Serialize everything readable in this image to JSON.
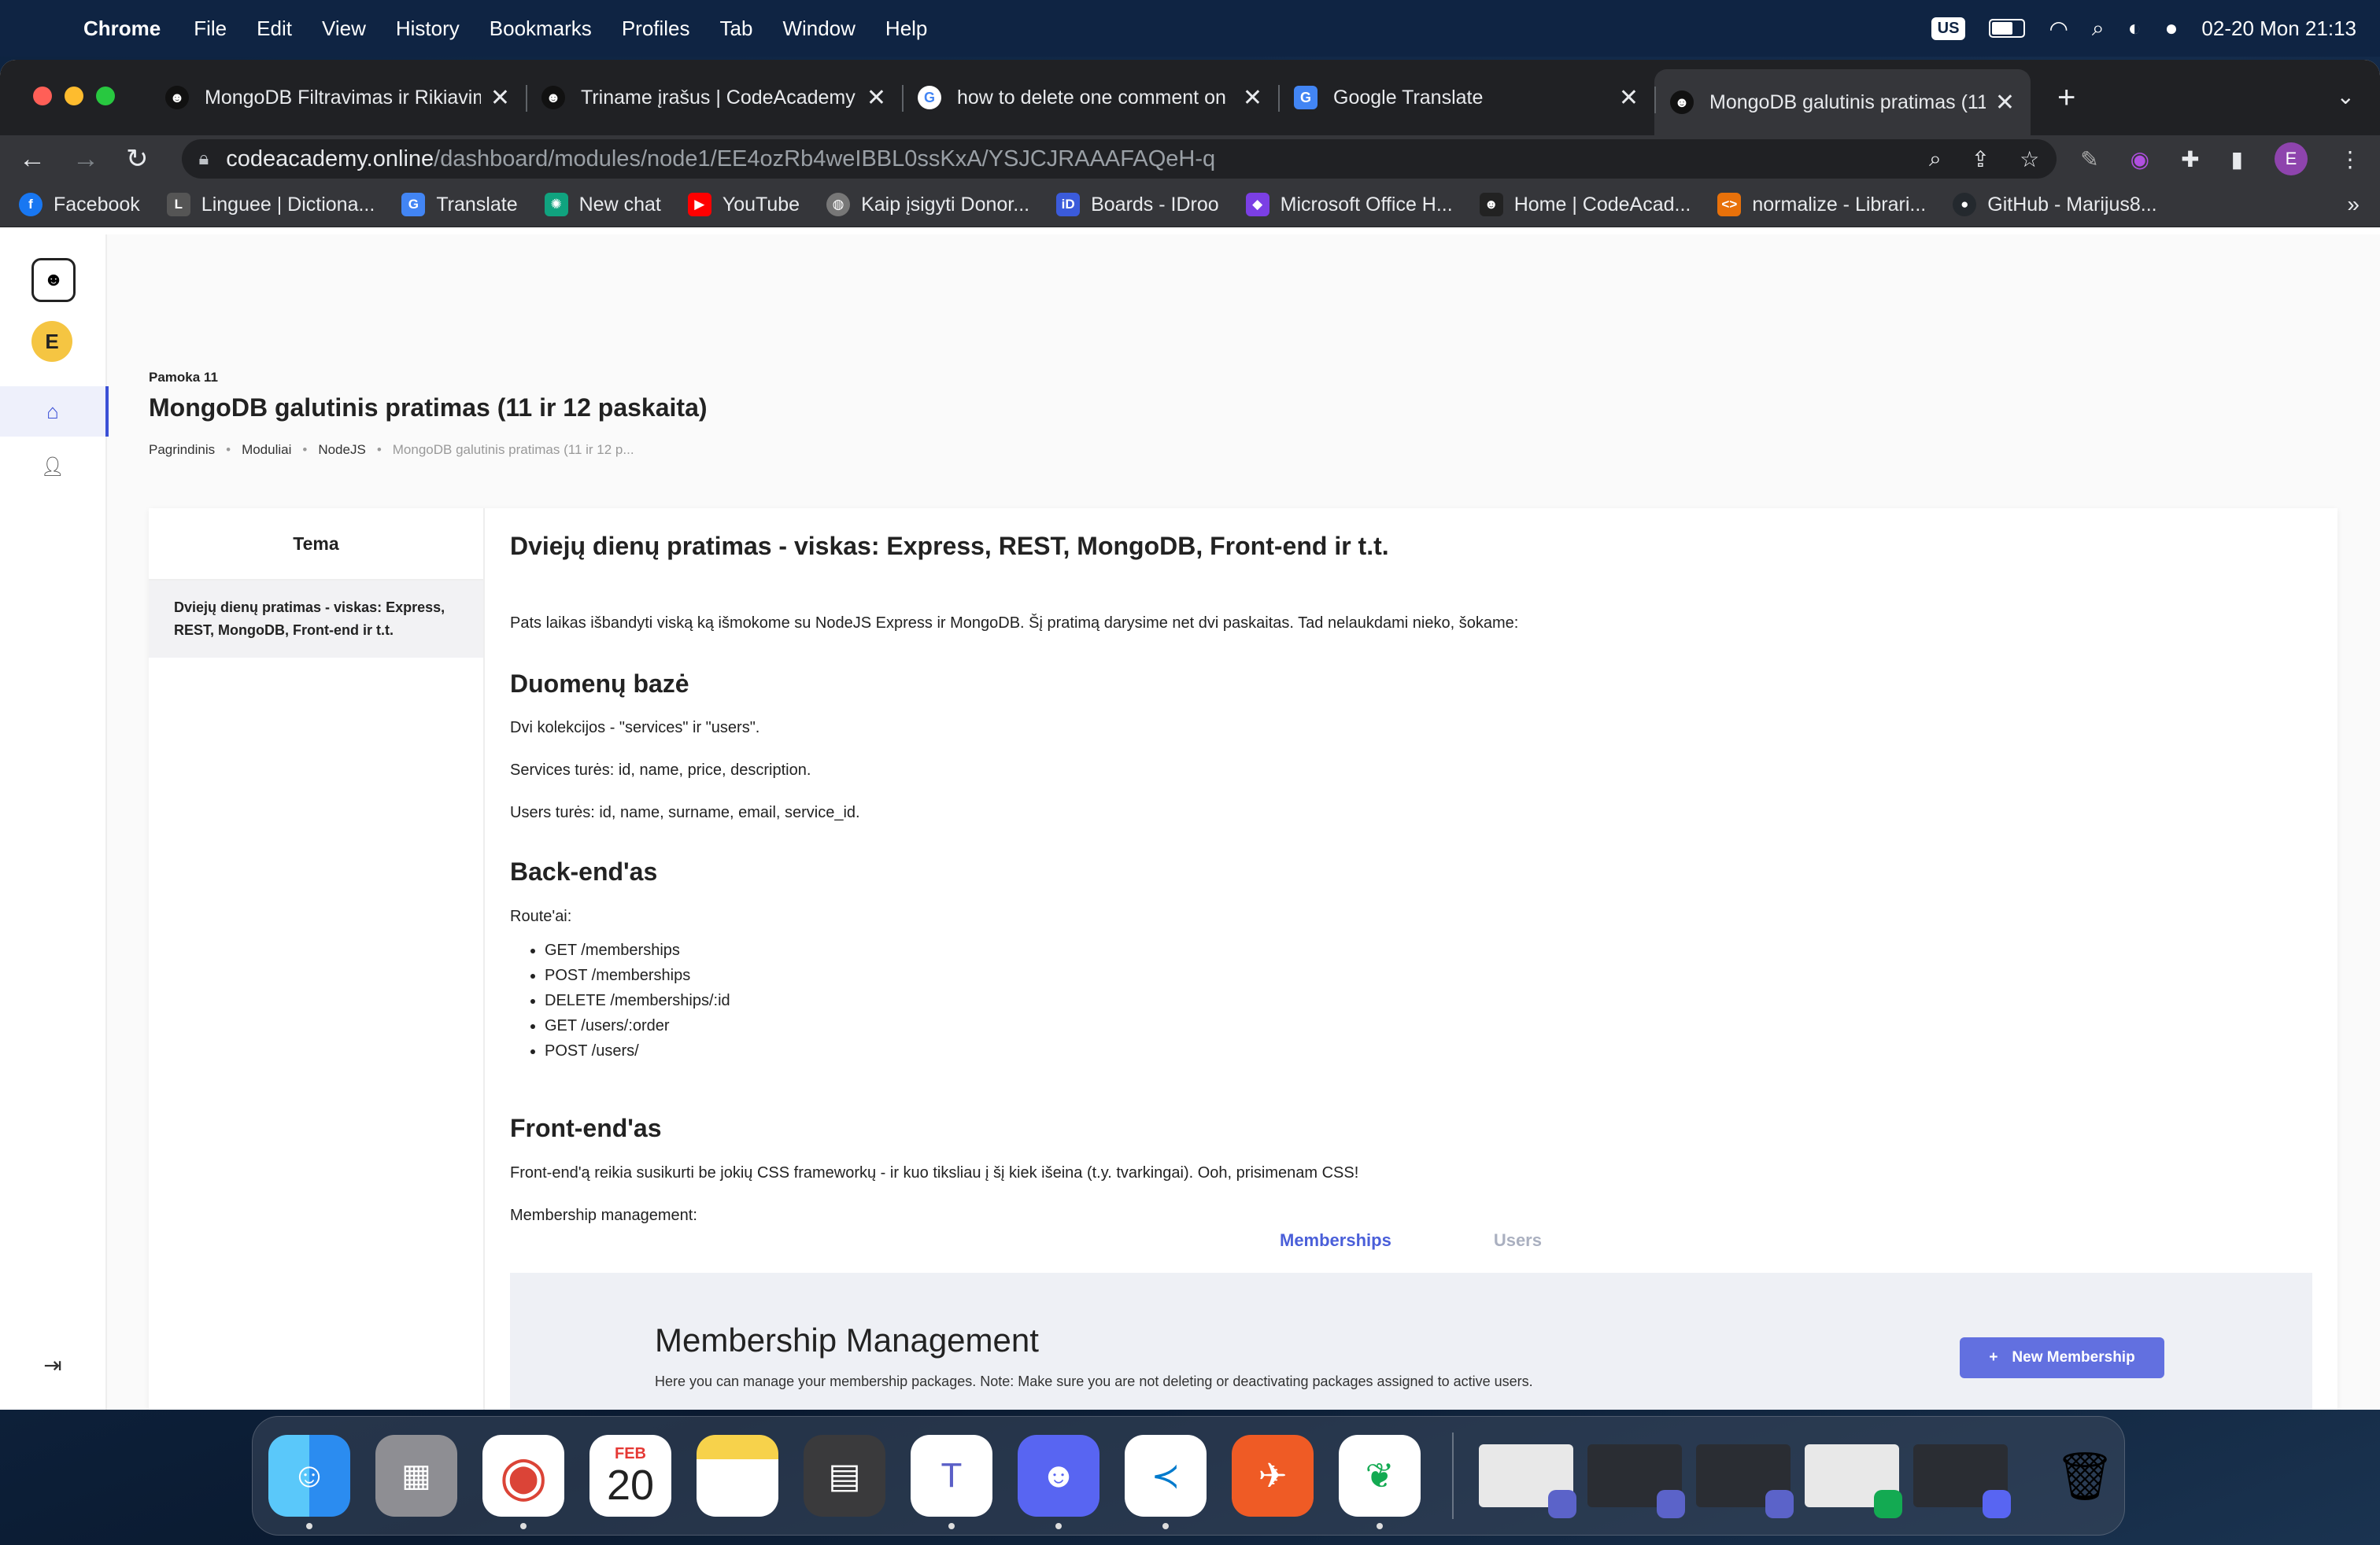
{
  "menubar": {
    "app": "Chrome",
    "items": [
      "File",
      "Edit",
      "View",
      "History",
      "Bookmarks",
      "Profiles",
      "Tab",
      "Window",
      "Help"
    ],
    "input_source": "US",
    "clock": "02-20 Mon  21:13"
  },
  "tabs": [
    {
      "title": "MongoDB Filtravimas ir Rikiavimas",
      "favicon": "codeacademy-icon"
    },
    {
      "title": "Triname įrašus | CodeAcademy",
      "favicon": "codeacademy-icon"
    },
    {
      "title": "how to delete one comment on",
      "favicon": "google-icon"
    },
    {
      "title": "Google Translate",
      "favicon": "translate-icon"
    },
    {
      "title": "MongoDB galutinis pratimas (11",
      "favicon": "codeacademy-icon",
      "active": true
    }
  ],
  "address": {
    "domain": "codeacademy.online",
    "path": "/dashboard/modules/node1/EE4ozRb4weIBBL0ssKxA/YSJCJRAAAFAQeH-q"
  },
  "bookmarks": [
    {
      "label": "Facebook",
      "color": "#1877f2",
      "glyph": "f"
    },
    {
      "label": "Linguee | Dictiona...",
      "color": "#555555",
      "glyph": "L"
    },
    {
      "label": "Translate",
      "color": "#4285f4",
      "glyph": "G"
    },
    {
      "label": "New chat",
      "color": "#10a37f",
      "glyph": "✺"
    },
    {
      "label": "YouTube",
      "color": "#ff0000",
      "glyph": "▶"
    },
    {
      "label": "Kaip įsigyti Donor...",
      "color": "#777777",
      "glyph": "◍"
    },
    {
      "label": "Boards - IDroo",
      "color": "#3b5bdb",
      "glyph": "iD"
    },
    {
      "label": "Microsoft Office H...",
      "color": "#7b3fe4",
      "glyph": "◆"
    },
    {
      "label": "Home | CodeAcad...",
      "color": "#222222",
      "glyph": "☻"
    },
    {
      "label": "normalize - Librari...",
      "color": "#e8710a",
      "glyph": "<>"
    },
    {
      "label": "GitHub - Marijus8...",
      "color": "#24292e",
      "glyph": "●"
    }
  ],
  "sidebar": {
    "user_initial": "E"
  },
  "lesson_header": {
    "pre_title": "Pamoka 11",
    "title": "MongoDB galutinis pratimas (11 ir 12 paskaita)",
    "breadcrumbs": [
      "Pagrindinis",
      "Moduliai",
      "NodeJS",
      "MongoDB galutinis pratimas (11 ir 12 p..."
    ]
  },
  "topics": {
    "heading": "Tema",
    "items": [
      "Dviejų dienų pratimas - viskas: Express, REST, MongoDB, Front-end ir t.t."
    ]
  },
  "lesson": {
    "heading": "Dviejų dienų pratimas - viskas: Express, REST, MongoDB, Front-end ir t.t.",
    "intro": "Pats laikas išbandyti viską ką išmokome su NodeJS Express ir MongoDB. Šį pratimą darysime net dvi paskaitas. Tad nelaukdami nieko, šokame:",
    "db_heading": "Duomenų bazė",
    "db_p1": "Dvi kolekcijos - \"services\" ir \"users\".",
    "db_p2": "Services turės: id, name, price, description.",
    "db_p3": "Users turės: id, name, surname, email, service_id.",
    "be_heading": "Back-end'as",
    "be_routes_label": "Route'ai:",
    "routes": [
      "GET /memberships",
      "POST /memberships",
      "DELETE /memberships/:id",
      "GET /users/:order",
      "POST /users/"
    ],
    "fe_heading": "Front-end'as",
    "fe_p1": "Front-end'ą reikia susikurti be jokių CSS frameworkų - ir kuo tiksliau į šį kiek išeina (t.y. tvarkingai). Ooh, prisimenam CSS!",
    "fe_p2": "Membership management:"
  },
  "preview": {
    "tab_memberships": "Memberships",
    "tab_users": "Users",
    "title": "Membership Management",
    "subtitle": "Here you can manage your membership packages. Note: Make sure you are not deleting or deactivating packages assigned to active users.",
    "button": "New Membership",
    "button_icon": "+"
  },
  "dock": {
    "calendar_month": "FEB",
    "calendar_day": "20"
  }
}
